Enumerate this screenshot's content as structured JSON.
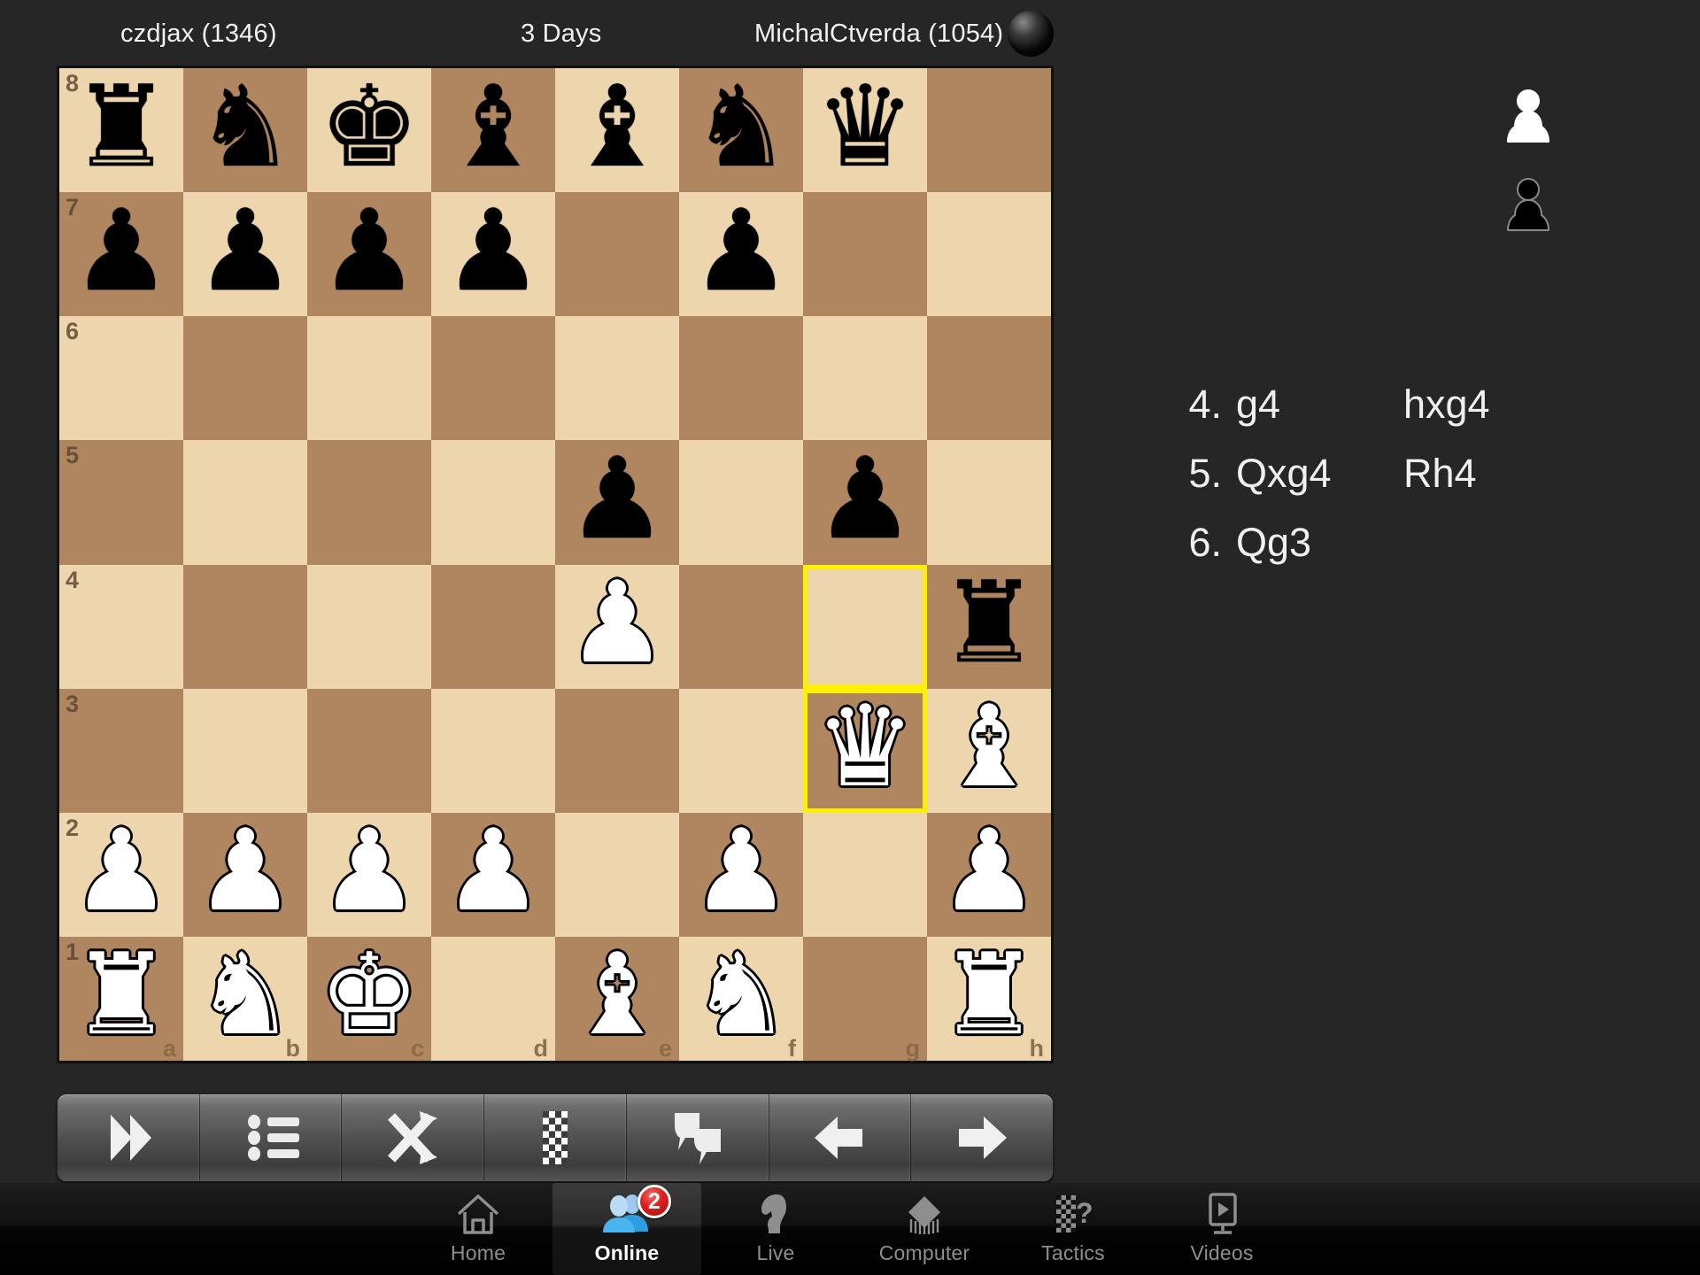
{
  "header": {
    "white_player": "czdjax (1346)",
    "time_control": "3 Days",
    "black_player": "MichalCtverda (1054)",
    "turn_indicator": "black-to-move-disc"
  },
  "board": {
    "light_square_color": "#EDD6AE",
    "dark_square_color": "#B08660",
    "highlight_color": "#FFF000",
    "orientation": "white-bottom-flipped-files",
    "rank_labels": [
      "8",
      "7",
      "6",
      "5",
      "4",
      "3",
      "2",
      "1"
    ],
    "file_labels": [
      "a",
      "b",
      "c",
      "d",
      "e",
      "f",
      "g",
      "h"
    ],
    "highlighted_squares": [
      "g4",
      "g3"
    ],
    "rows": [
      {
        "rank": "8",
        "squares": [
          {
            "file": "a",
            "piece": "r",
            "color": "b"
          },
          {
            "file": "b",
            "piece": "n",
            "color": "b"
          },
          {
            "file": "c",
            "piece": "k",
            "color": "b"
          },
          {
            "file": "d",
            "piece": "b",
            "color": "b"
          },
          {
            "file": "e",
            "piece": "b",
            "color": "b"
          },
          {
            "file": "f",
            "piece": "n",
            "color": "b"
          },
          {
            "file": "g",
            "piece": "q",
            "color": "b"
          },
          {
            "file": "h",
            "piece": "",
            "color": ""
          }
        ]
      },
      {
        "rank": "7",
        "squares": [
          {
            "file": "a",
            "piece": "p",
            "color": "b"
          },
          {
            "file": "b",
            "piece": "p",
            "color": "b"
          },
          {
            "file": "c",
            "piece": "p",
            "color": "b"
          },
          {
            "file": "d",
            "piece": "p",
            "color": "b"
          },
          {
            "file": "e",
            "piece": "",
            "color": ""
          },
          {
            "file": "f",
            "piece": "p",
            "color": "b"
          },
          {
            "file": "g",
            "piece": "",
            "color": ""
          },
          {
            "file": "h",
            "piece": "",
            "color": ""
          }
        ]
      },
      {
        "rank": "6",
        "squares": [
          {
            "file": "a",
            "piece": "",
            "color": ""
          },
          {
            "file": "b",
            "piece": "",
            "color": ""
          },
          {
            "file": "c",
            "piece": "",
            "color": ""
          },
          {
            "file": "d",
            "piece": "",
            "color": ""
          },
          {
            "file": "e",
            "piece": "",
            "color": ""
          },
          {
            "file": "f",
            "piece": "",
            "color": ""
          },
          {
            "file": "g",
            "piece": "",
            "color": ""
          },
          {
            "file": "h",
            "piece": "",
            "color": ""
          }
        ]
      },
      {
        "rank": "5",
        "squares": [
          {
            "file": "a",
            "piece": "",
            "color": ""
          },
          {
            "file": "b",
            "piece": "",
            "color": ""
          },
          {
            "file": "c",
            "piece": "",
            "color": ""
          },
          {
            "file": "d",
            "piece": "",
            "color": ""
          },
          {
            "file": "e",
            "piece": "p",
            "color": "b"
          },
          {
            "file": "f",
            "piece": "",
            "color": ""
          },
          {
            "file": "g",
            "piece": "p",
            "color": "b"
          },
          {
            "file": "h",
            "piece": "",
            "color": ""
          }
        ]
      },
      {
        "rank": "4",
        "squares": [
          {
            "file": "a",
            "piece": "",
            "color": ""
          },
          {
            "file": "b",
            "piece": "",
            "color": ""
          },
          {
            "file": "c",
            "piece": "",
            "color": ""
          },
          {
            "file": "d",
            "piece": "",
            "color": ""
          },
          {
            "file": "e",
            "piece": "p",
            "color": "w"
          },
          {
            "file": "f",
            "piece": "",
            "color": ""
          },
          {
            "file": "g",
            "piece": "",
            "color": "",
            "highlight": true
          },
          {
            "file": "h",
            "piece": "r",
            "color": "b"
          }
        ]
      },
      {
        "rank": "3",
        "squares": [
          {
            "file": "a",
            "piece": "",
            "color": ""
          },
          {
            "file": "b",
            "piece": "",
            "color": ""
          },
          {
            "file": "c",
            "piece": "",
            "color": ""
          },
          {
            "file": "d",
            "piece": "",
            "color": ""
          },
          {
            "file": "e",
            "piece": "",
            "color": ""
          },
          {
            "file": "f",
            "piece": "",
            "color": ""
          },
          {
            "file": "g",
            "piece": "q",
            "color": "w",
            "highlight": true
          },
          {
            "file": "h",
            "piece": "b",
            "color": "w"
          }
        ]
      },
      {
        "rank": "2",
        "squares": [
          {
            "file": "a",
            "piece": "p",
            "color": "w"
          },
          {
            "file": "b",
            "piece": "p",
            "color": "w"
          },
          {
            "file": "c",
            "piece": "p",
            "color": "w"
          },
          {
            "file": "d",
            "piece": "p",
            "color": "w"
          },
          {
            "file": "e",
            "piece": "",
            "color": ""
          },
          {
            "file": "f",
            "piece": "p",
            "color": "w"
          },
          {
            "file": "g",
            "piece": "",
            "color": ""
          },
          {
            "file": "h",
            "piece": "p",
            "color": "w"
          }
        ]
      },
      {
        "rank": "1",
        "squares": [
          {
            "file": "a",
            "piece": "r",
            "color": "w"
          },
          {
            "file": "b",
            "piece": "n",
            "color": "w"
          },
          {
            "file": "c",
            "piece": "k",
            "color": "w"
          },
          {
            "file": "d",
            "piece": "",
            "color": ""
          },
          {
            "file": "e",
            "piece": "b",
            "color": "w"
          },
          {
            "file": "f",
            "piece": "n",
            "color": "w"
          },
          {
            "file": "g",
            "piece": "",
            "color": ""
          },
          {
            "file": "h",
            "piece": "r",
            "color": "w"
          }
        ]
      }
    ]
  },
  "captured": [
    {
      "name": "captured-white-pawn",
      "color": "white"
    },
    {
      "name": "captured-black-pawn",
      "color": "black"
    }
  ],
  "moves": [
    {
      "number": "4.",
      "white": "g4",
      "black": "hxg4"
    },
    {
      "number": "5.",
      "white": "Qxg4",
      "black": "Rh4"
    },
    {
      "number": "6.",
      "white": "Qg3",
      "black": ""
    }
  ],
  "toolbar": [
    {
      "name": "next-game-button",
      "icon": "fast-forward-icon"
    },
    {
      "name": "move-list-button",
      "icon": "list-icon"
    },
    {
      "name": "flip-board-button",
      "icon": "shuffle-icon"
    },
    {
      "name": "board-settings-button",
      "icon": "chessboard-icon"
    },
    {
      "name": "chat-button",
      "icon": "chat-bubbles-icon"
    },
    {
      "name": "previous-move-button",
      "icon": "arrow-left-icon"
    },
    {
      "name": "next-move-button",
      "icon": "arrow-right-icon"
    }
  ],
  "tabbar": [
    {
      "label": "Home",
      "icon": "home-icon",
      "active": false,
      "badge": ""
    },
    {
      "label": "Online",
      "icon": "people-icon",
      "active": true,
      "badge": "2"
    },
    {
      "label": "Live",
      "icon": "knight-icon",
      "active": false,
      "badge": ""
    },
    {
      "label": "Computer",
      "icon": "chip-icon",
      "active": false,
      "badge": ""
    },
    {
      "label": "Tactics",
      "icon": "tactics-icon",
      "active": false,
      "badge": ""
    },
    {
      "label": "Videos",
      "icon": "video-play-icon",
      "active": false,
      "badge": ""
    }
  ]
}
